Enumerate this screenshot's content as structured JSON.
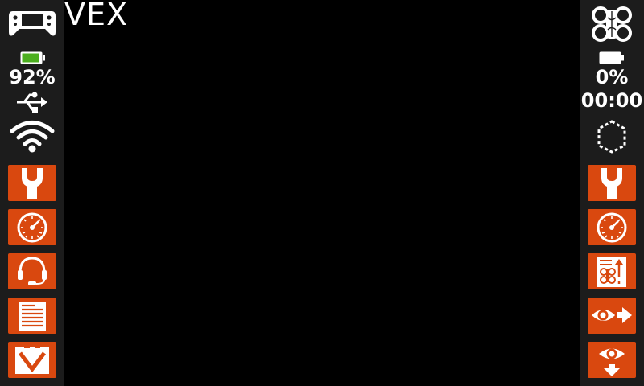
{
  "title": "VEX",
  "colors": {
    "background": "#000000",
    "sidebar": "#1c1c1c",
    "accent": "#d9480f",
    "text": "#ffffff",
    "battery_good": "#4caf1f"
  },
  "left_panel": {
    "status_icons": [
      "controller-icon",
      "battery-icon",
      "usb-icon",
      "wifi-icon"
    ],
    "battery_percent": "92%",
    "battery_level": 0.92,
    "buttons": [
      {
        "name": "settings-button",
        "icon": "wrench-icon"
      },
      {
        "name": "devices-button",
        "icon": "gauge-icon"
      },
      {
        "name": "headset-button",
        "icon": "headset-icon"
      },
      {
        "name": "program-list-button",
        "icon": "document-icon"
      },
      {
        "name": "drive-button",
        "icon": "chevron-down-icon"
      }
    ]
  },
  "right_panel": {
    "status_icons": [
      "robot-brain-icon",
      "battery-icon",
      "field-outline-icon"
    ],
    "battery_percent": "0%",
    "battery_level": 0.0,
    "timer": "00:00",
    "buttons": [
      {
        "name": "robot-settings-button",
        "icon": "wrench-icon"
      },
      {
        "name": "robot-devices-button",
        "icon": "gauge-icon"
      },
      {
        "name": "robot-program-button",
        "icon": "program-doc-icon"
      },
      {
        "name": "view-forward-button",
        "icon": "eye-arrow-icon"
      },
      {
        "name": "view-down-button",
        "icon": "eye-down-icon"
      }
    ]
  }
}
